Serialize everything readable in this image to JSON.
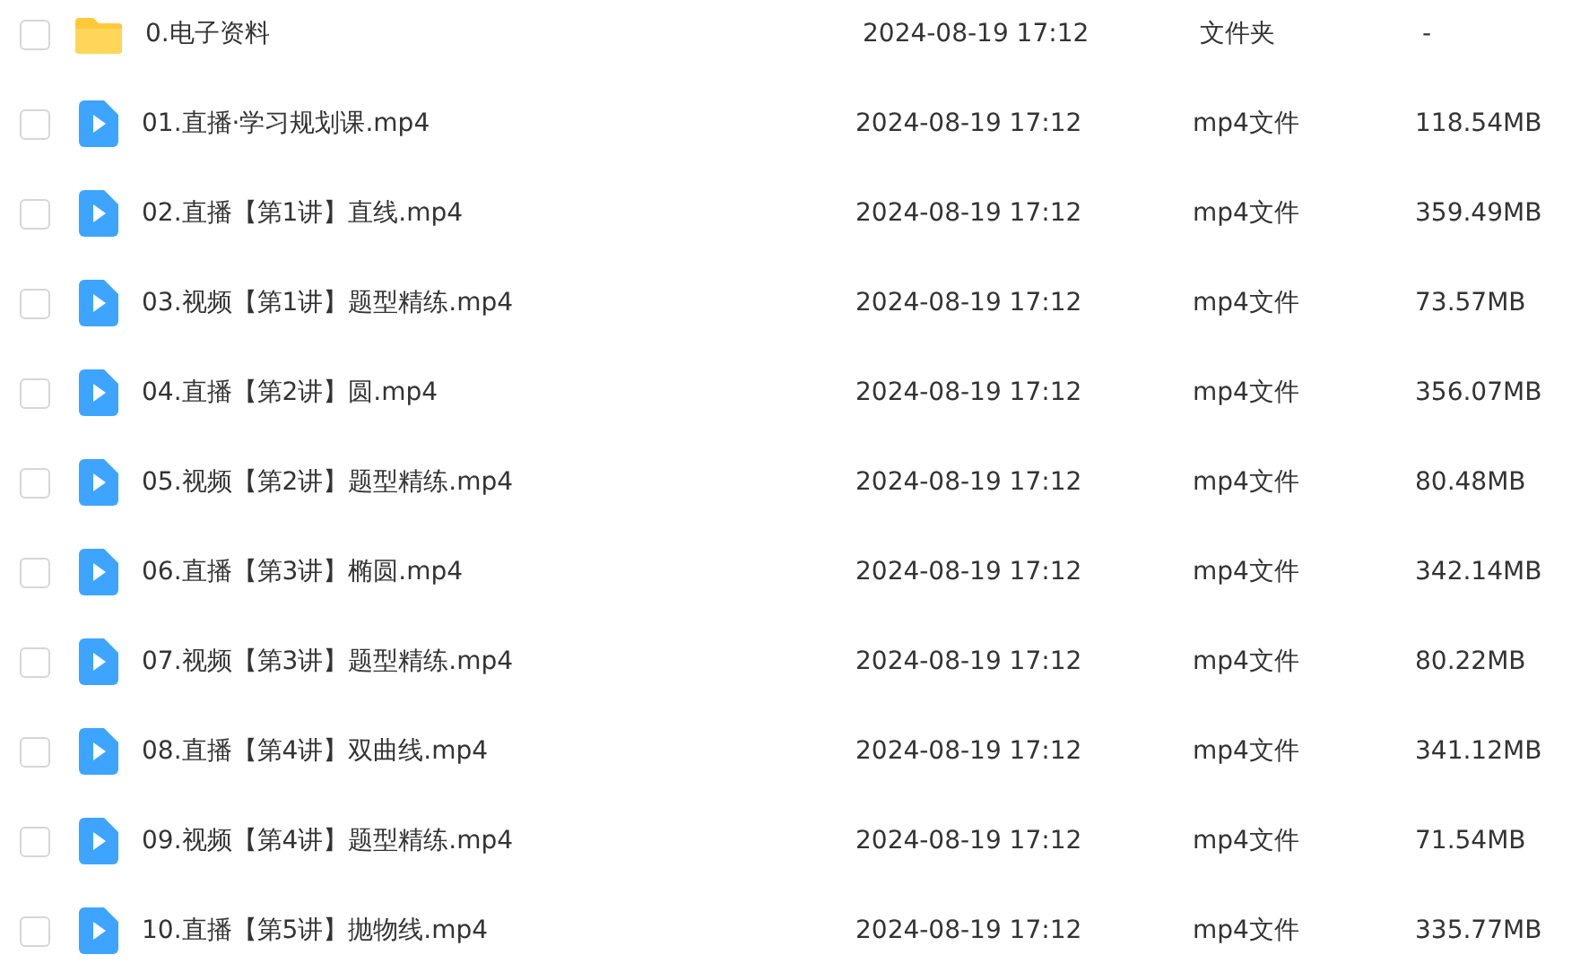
{
  "files": [
    {
      "kind": "folder",
      "name": "0.电子资料",
      "modified": "2024-08-19 17:12",
      "type": "文件夹",
      "size": "-",
      "checked": false
    },
    {
      "kind": "video",
      "name": "01.直播·学习规划课.mp4",
      "modified": "2024-08-19 17:12",
      "type": "mp4文件",
      "size": "118.54MB",
      "checked": false
    },
    {
      "kind": "video",
      "name": "02.直播【第1讲】直线.mp4",
      "modified": "2024-08-19 17:12",
      "type": "mp4文件",
      "size": "359.49MB",
      "checked": false
    },
    {
      "kind": "video",
      "name": "03.视频【第1讲】题型精练.mp4",
      "modified": "2024-08-19 17:12",
      "type": "mp4文件",
      "size": "73.57MB",
      "checked": false
    },
    {
      "kind": "video",
      "name": "04.直播【第2讲】圆.mp4",
      "modified": "2024-08-19 17:12",
      "type": "mp4文件",
      "size": "356.07MB",
      "checked": false
    },
    {
      "kind": "video",
      "name": "05.视频【第2讲】题型精练.mp4",
      "modified": "2024-08-19 17:12",
      "type": "mp4文件",
      "size": "80.48MB",
      "checked": false
    },
    {
      "kind": "video",
      "name": "06.直播【第3讲】椭圆.mp4",
      "modified": "2024-08-19 17:12",
      "type": "mp4文件",
      "size": "342.14MB",
      "checked": false
    },
    {
      "kind": "video",
      "name": "07.视频【第3讲】题型精练.mp4",
      "modified": "2024-08-19 17:12",
      "type": "mp4文件",
      "size": "80.22MB",
      "checked": false
    },
    {
      "kind": "video",
      "name": "08.直播【第4讲】双曲线.mp4",
      "modified": "2024-08-19 17:12",
      "type": "mp4文件",
      "size": "341.12MB",
      "checked": false
    },
    {
      "kind": "video",
      "name": "09.视频【第4讲】题型精练.mp4",
      "modified": "2024-08-19 17:12",
      "type": "mp4文件",
      "size": "71.54MB",
      "checked": false
    },
    {
      "kind": "video",
      "name": "10.直播【第5讲】抛物线.mp4",
      "modified": "2024-08-19 17:12",
      "type": "mp4文件",
      "size": "335.77MB",
      "checked": false
    }
  ]
}
